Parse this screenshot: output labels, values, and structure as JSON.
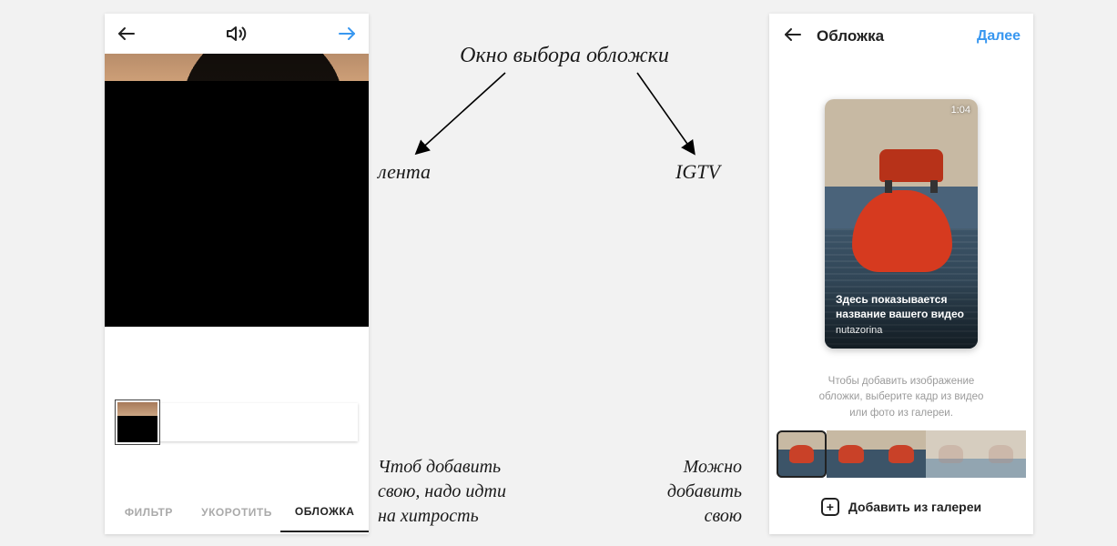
{
  "annotations": {
    "title": "Окно выбора обложки",
    "left_label": "лента",
    "right_label": "IGTV",
    "left_note_l1": "Чтоб добавить",
    "left_note_l2": "свою, надо идти",
    "left_note_l3": "на хитрость",
    "right_note_l1": "Можно",
    "right_note_l2": "добавить",
    "right_note_l3": "свою"
  },
  "feed": {
    "tabs": {
      "filter": "ФИЛЬТР",
      "trim": "УКОРОТИТЬ",
      "cover": "ОБЛОЖКА"
    }
  },
  "igtv": {
    "header_title": "Обложка",
    "next": "Далее",
    "duration": "1:04",
    "overlay_title_l1": "Здесь показывается",
    "overlay_title_l2": "название вашего видео",
    "overlay_user": "nutazorina",
    "hint_l1": "Чтобы добавить изображение",
    "hint_l2": "обложки, выберите кадр из видео",
    "hint_l3": "или фото из галереи.",
    "add_from_gallery": "Добавить из галереи"
  }
}
